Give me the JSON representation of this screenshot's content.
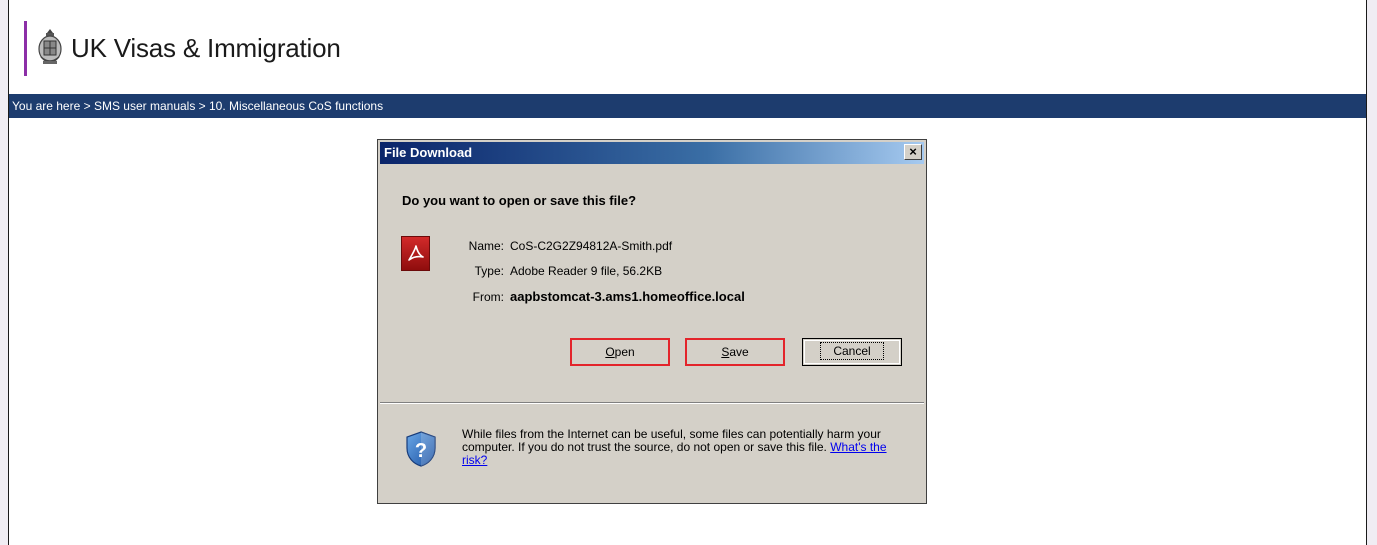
{
  "header": {
    "brand": "UK Visas & Immigration"
  },
  "breadcrumb": {
    "text": "You are here > SMS user manuals > 10. Miscellaneous CoS functions"
  },
  "dialog": {
    "title": "File Download",
    "close_symbol": "×",
    "question": "Do you want to open or save this file?",
    "file": {
      "name_label": "Name:",
      "name_value": "CoS-C2G2Z94812A-Smith.pdf",
      "type_label": "Type:",
      "type_value": "Adobe Reader 9 file, 56.2KB",
      "from_label": "From:",
      "from_value": "aapbstomcat-3.ams1.homeoffice.local"
    },
    "buttons": {
      "open_key": "O",
      "open_rest": "pen",
      "save_key": "S",
      "save_rest": "ave",
      "cancel": "Cancel"
    },
    "warning": {
      "text": "While files from the Internet can be useful, some files can potentially harm your computer. If you do not trust the source, do not open or save this file.",
      "link": "What's the risk?"
    }
  },
  "colors": {
    "breadcrumb_bg": "#1d3c6e",
    "brand_accent": "#8c2fa7",
    "highlight": "#e3242b",
    "dialog_bg": "#d4d0c8"
  },
  "icons": [
    "crest-icon",
    "close-icon",
    "pdf-file-icon",
    "security-shield-icon"
  ]
}
